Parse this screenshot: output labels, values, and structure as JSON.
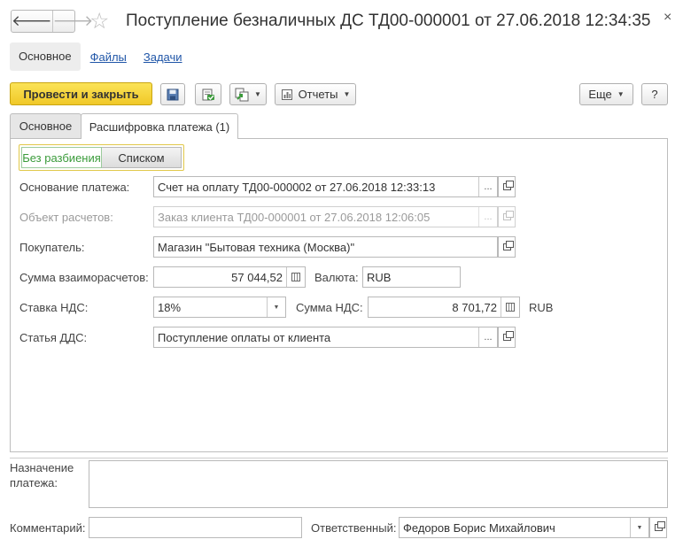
{
  "header": {
    "back_glyph": "🡐",
    "forward_glyph": "🡒",
    "star_glyph": "☆",
    "title": "Поступление безналичных ДС ТД00-000001 от 27.06.2018 12:34:35",
    "close_glyph": "×"
  },
  "sections": {
    "current": "Основное",
    "files": "Файлы",
    "tasks": "Задачи"
  },
  "toolbar": {
    "post_close_label": "Провести и закрыть",
    "reports_label": "Отчеты",
    "more_label": "Еще",
    "help_label": "?",
    "caret": "▼"
  },
  "tabs": {
    "main": "Основное",
    "breakdown": "Расшифровка платежа (1)"
  },
  "split_switch": {
    "no_split": "Без разбиения",
    "list": "Списком"
  },
  "form": {
    "payment_basis_label": "Основание платежа:",
    "payment_basis_value": "Счет на оплату ТД00-000002 от 27.06.2018 12:33:13",
    "settlement_object_label": "Объект расчетов:",
    "settlement_object_value": "Заказ клиента ТД00-000001 от 27.06.2018 12:06:05",
    "buyer_label": "Покупатель:",
    "buyer_value": "Магазин \"Бытовая техника (Москва)\"",
    "settlement_sum_label": "Сумма взаиморасчетов:",
    "settlement_sum_value": "57 044,52",
    "currency_label": "Валюта:",
    "currency_value": "RUB",
    "vat_rate_label": "Ставка НДС:",
    "vat_rate_value": "18%",
    "vat_sum_label": "Сумма НДС:",
    "vat_sum_value": "8 701,72",
    "vat_currency": "RUB",
    "cash_flow_label": "Статья ДДС:",
    "cash_flow_value": "Поступление оплаты от клиента",
    "choice_glyph": "...",
    "dropdown_glyph": "▼"
  },
  "footer": {
    "purpose_label_1": "Назначение",
    "purpose_label_2": "платежа:",
    "purpose_value": "",
    "comment_label": "Комментарий:",
    "comment_value": "",
    "responsible_label": "Ответственный:",
    "responsible_value": "Федоров Борис Михайлович"
  }
}
